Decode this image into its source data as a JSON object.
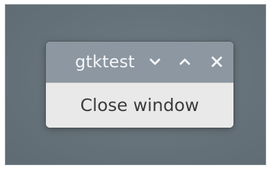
{
  "window": {
    "title": "gtktest",
    "button_label": "Close window"
  },
  "icons": {
    "menu": "chevron-down-icon",
    "maximize": "chevron-up-icon",
    "close": "close-icon"
  },
  "colors": {
    "titlebar": "#8d97a1",
    "title_text": "#f4f6f8",
    "content_bg": "#e9e9e9",
    "desktop": "#6b777f"
  }
}
